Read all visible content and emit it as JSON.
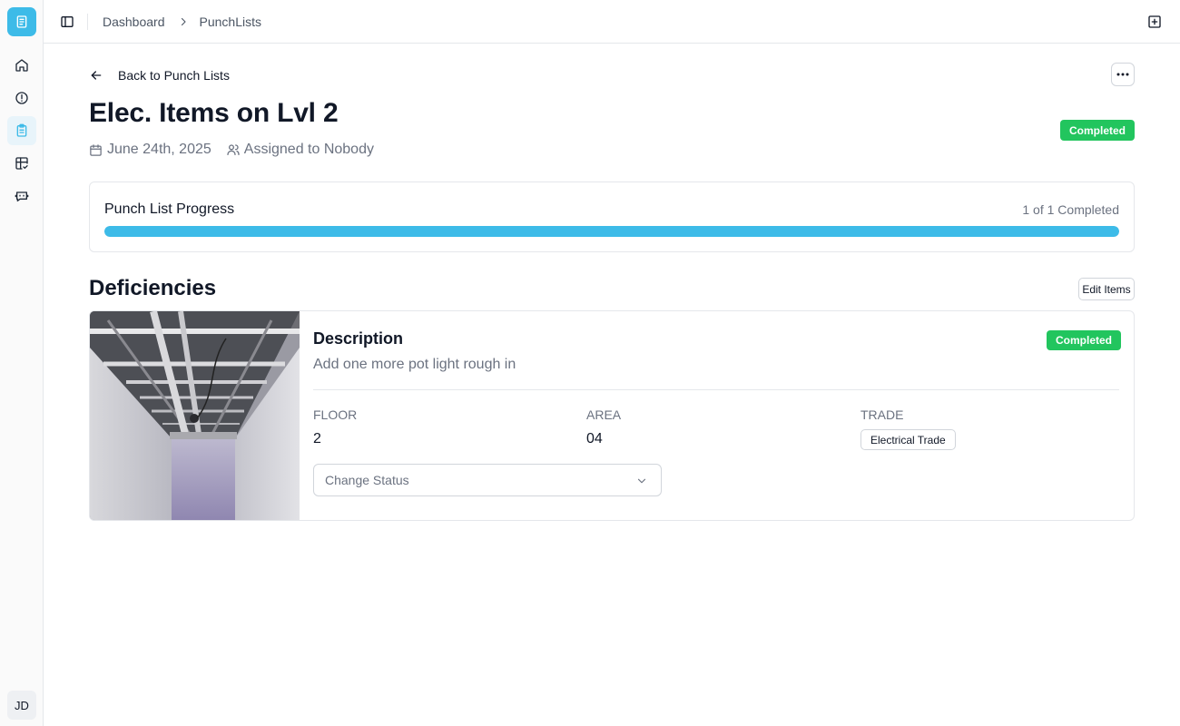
{
  "sidebar": {
    "logo_icon": "clipboard-icon",
    "items": [
      {
        "icon": "home-icon",
        "active": false
      },
      {
        "icon": "alert-circle-icon",
        "active": false
      },
      {
        "icon": "clipboard-list-icon",
        "active": true
      },
      {
        "icon": "layout-check-icon",
        "active": false
      },
      {
        "icon": "bot-icon",
        "active": false
      }
    ],
    "avatar_initials": "JD"
  },
  "topbar": {
    "breadcrumb": [
      "Dashboard",
      "PunchLists"
    ]
  },
  "back_label": "Back to Punch Lists",
  "page": {
    "title": "Elec. Items on Lvl 2",
    "date": "June 24th, 2025",
    "assigned": "Assigned to Nobody",
    "status": "Completed"
  },
  "progress": {
    "title": "Punch List Progress",
    "count_label": "1 of 1 Completed",
    "fraction": 1.0
  },
  "deficiencies": {
    "title": "Deficiencies",
    "edit_label": "Edit Items",
    "items": [
      {
        "description_label": "Description",
        "description": "Add one more pot light rough in",
        "status": "Completed",
        "floor_label": "FLOOR",
        "floor": "2",
        "area_label": "AREA",
        "area": "04",
        "trade_label": "TRADE",
        "trade": "Electrical Trade",
        "select_placeholder": "Change Status"
      }
    ]
  },
  "colors": {
    "accent": "#3dbbe8",
    "success": "#22c55e"
  }
}
